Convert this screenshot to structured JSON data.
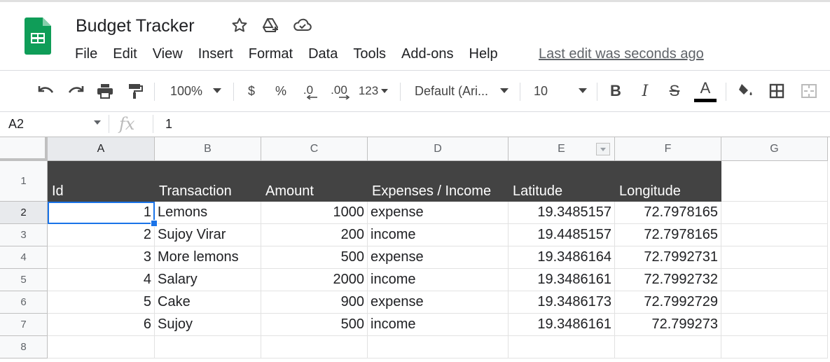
{
  "doc": {
    "title": "Budget Tracker",
    "last_edit": "Last edit was seconds ago"
  },
  "menu": [
    "File",
    "Edit",
    "View",
    "Insert",
    "Format",
    "Data",
    "Tools",
    "Add-ons",
    "Help"
  ],
  "toolbar": {
    "zoom": "100%",
    "currency": "$",
    "percent": "%",
    "decrease_decimal": ".0",
    "increase_decimal": ".00",
    "more_formats": "123",
    "font": "Default (Ari...",
    "font_size": "10",
    "bold": "B",
    "italic": "I",
    "strike": "S",
    "text_color_letter": "A"
  },
  "formula": {
    "name_box": "A2",
    "fx": "fx",
    "value": "1"
  },
  "columns": [
    "A",
    "B",
    "C",
    "D",
    "E",
    "F",
    "G"
  ],
  "rows": [
    "1",
    "2",
    "3",
    "4",
    "5",
    "6",
    "7",
    "8"
  ],
  "table": {
    "headers": [
      "Id",
      "Transaction",
      "Amount",
      "Expenses / Income",
      "Latitude",
      "Longitude"
    ],
    "rows": [
      [
        "1",
        "Lemons",
        "1000",
        "expense",
        "19.3485157",
        "72.7978165"
      ],
      [
        "2",
        "Sujoy Virar",
        "200",
        "income",
        "19.4485157",
        "72.7978165"
      ],
      [
        "3",
        "More lemons",
        "500",
        "expense",
        "19.3486164",
        "72.7992731"
      ],
      [
        "4",
        "Salary",
        "2000",
        "income",
        "19.3486161",
        "72.7992732"
      ],
      [
        "5",
        "Cake",
        "900",
        "expense",
        "19.3486173",
        "72.7992729"
      ],
      [
        "6",
        "Sujoy",
        "500",
        "income",
        "19.3486161",
        "72.799273"
      ]
    ]
  },
  "colors": {
    "header_fill": "#434343",
    "selection": "#1a73e8",
    "logo": "#0f9d58"
  }
}
